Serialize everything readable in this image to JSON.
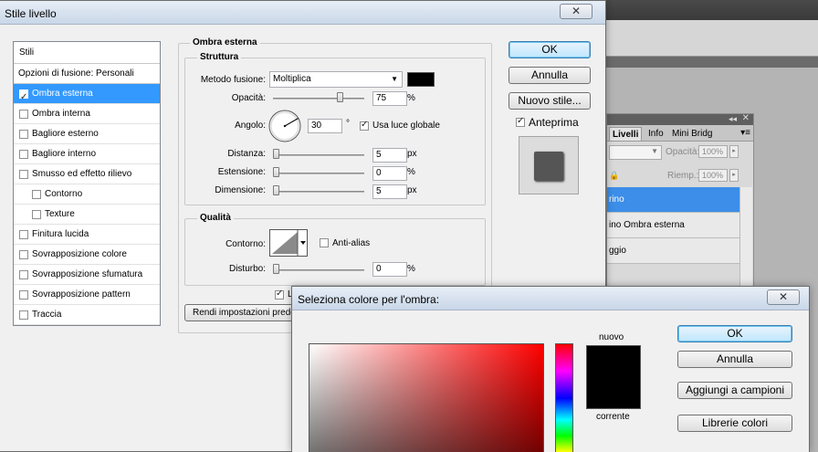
{
  "layer_style": {
    "title": "Stile livello",
    "close_glyph": "✕",
    "list_header": "Stili",
    "blend_options": "Opzioni di fusione: Personali",
    "styles": [
      {
        "label": "Ombra esterna",
        "checked": true,
        "selected": true,
        "indent": false
      },
      {
        "label": "Ombra interna",
        "checked": false,
        "selected": false,
        "indent": false
      },
      {
        "label": "Bagliore esterno",
        "checked": false,
        "selected": false,
        "indent": false
      },
      {
        "label": "Bagliore interno",
        "checked": false,
        "selected": false,
        "indent": false
      },
      {
        "label": "Smusso ed effetto rilievo",
        "checked": false,
        "selected": false,
        "indent": false
      },
      {
        "label": "Contorno",
        "checked": false,
        "selected": false,
        "indent": true
      },
      {
        "label": "Texture",
        "checked": false,
        "selected": false,
        "indent": true
      },
      {
        "label": "Finitura lucida",
        "checked": false,
        "selected": false,
        "indent": false
      },
      {
        "label": "Sovrapposizione colore",
        "checked": false,
        "selected": false,
        "indent": false
      },
      {
        "label": "Sovrapposizione sfumatura",
        "checked": false,
        "selected": false,
        "indent": false
      },
      {
        "label": "Sovrapposizione pattern",
        "checked": false,
        "selected": false,
        "indent": false
      },
      {
        "label": "Traccia",
        "checked": false,
        "selected": false,
        "indent": false
      }
    ],
    "section_title": "Ombra esterna",
    "structure": {
      "title": "Struttura",
      "blend_mode_label": "Metodo fusione:",
      "blend_mode_value": "Moltiplica",
      "shadow_color": "#000000",
      "opacity_label": "Opacità:",
      "opacity_value": "75",
      "opacity_unit": "%",
      "angle_label": "Angolo:",
      "angle_value": "30",
      "angle_unit": "°",
      "global_light_label": "Usa luce globale",
      "distance_label": "Distanza:",
      "distance_value": "5",
      "distance_unit": "px",
      "spread_label": "Estensione:",
      "spread_value": "0",
      "spread_unit": "%",
      "size_label": "Dimensione:",
      "size_value": "5",
      "size_unit": "px"
    },
    "quality": {
      "title": "Qualità",
      "contour_label": "Contorno:",
      "antialias_label": "Anti-alias",
      "noise_label": "Disturbo:",
      "noise_value": "0",
      "noise_unit": "%"
    },
    "knockout_partial": "L",
    "default_button_partial": "Rendi impostazioni predo",
    "buttons": {
      "ok": "OK",
      "cancel": "Annulla",
      "new_style": "Nuovo stile...",
      "preview": "Anteprima"
    }
  },
  "layers_panel": {
    "tabs": [
      "Livelli",
      "Info",
      "Mini Bridg"
    ],
    "opacity_label": "Opacità:",
    "opacity_value": "100%",
    "fill_label": "Riemp.:",
    "fill_value": "100%",
    "layers": [
      {
        "name": "rino",
        "selected": true
      },
      {
        "name": "ino Ombra esterna",
        "selected": false
      },
      {
        "name": "ggio",
        "selected": false
      }
    ]
  },
  "color_picker": {
    "title": "Seleziona colore per l'ombra:",
    "close_glyph": "✕",
    "new_label": "nuovo",
    "current_label": "corrente",
    "new_color": "#000000",
    "current_color": "#000000",
    "buttons": {
      "ok": "OK",
      "cancel": "Annulla",
      "add_swatches": "Aggiungi a campioni",
      "color_libraries": "Librerie colori"
    }
  }
}
